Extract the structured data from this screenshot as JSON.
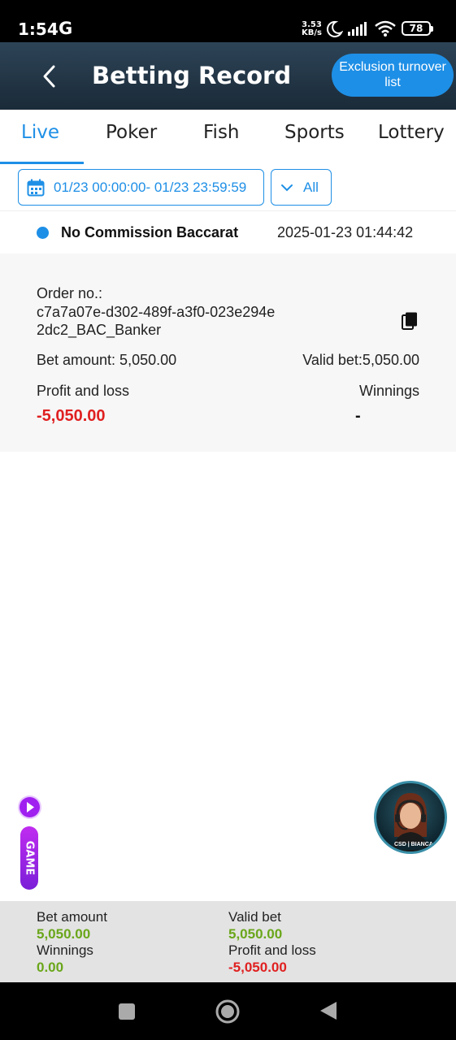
{
  "status_bar": {
    "time": "1:54",
    "g_label": "G",
    "net_speed": "3.53",
    "net_unit": "KB/s",
    "battery": "78"
  },
  "header": {
    "title": "Betting Record",
    "exclusion_button": "Exclusion turnover list"
  },
  "tabs": [
    {
      "label": "Live",
      "active": true
    },
    {
      "label": "Poker",
      "active": false
    },
    {
      "label": "Fish",
      "active": false
    },
    {
      "label": "Sports",
      "active": false
    },
    {
      "label": "Lottery",
      "active": false
    }
  ],
  "filters": {
    "date_range": "01/23 00:00:00- 01/23 23:59:59",
    "type": "All"
  },
  "record": {
    "game": "No Commission Baccarat",
    "time": "2025-01-23 01:44:42",
    "order_label": "Order no.:",
    "order_no": "c7a7a07e-d302-489f-a3f0-023e294e2dc2_BAC_Banker",
    "bet_amount": "Bet amount: 5,050.00",
    "valid_bet": "Valid bet:5,050.00",
    "profit_label": "Profit and loss",
    "profit_value": "-5,050.00",
    "winnings_label": "Winnings",
    "winnings_value": "-"
  },
  "float": {
    "game_label": "GAME",
    "support_badge": "CSD | BIANCA"
  },
  "summary": {
    "bet_amount_label": "Bet amount",
    "bet_amount_value": "5,050.00",
    "valid_bet_label": "Valid bet",
    "valid_bet_value": "5,050.00",
    "winnings_label": "Winnings",
    "winnings_value": "0.00",
    "profit_label": "Profit and loss",
    "profit_value": "-5,050.00"
  },
  "colors": {
    "accent": "#1e8fe6",
    "loss": "#e02020",
    "gain": "#6aa61a",
    "header": "#233746"
  }
}
